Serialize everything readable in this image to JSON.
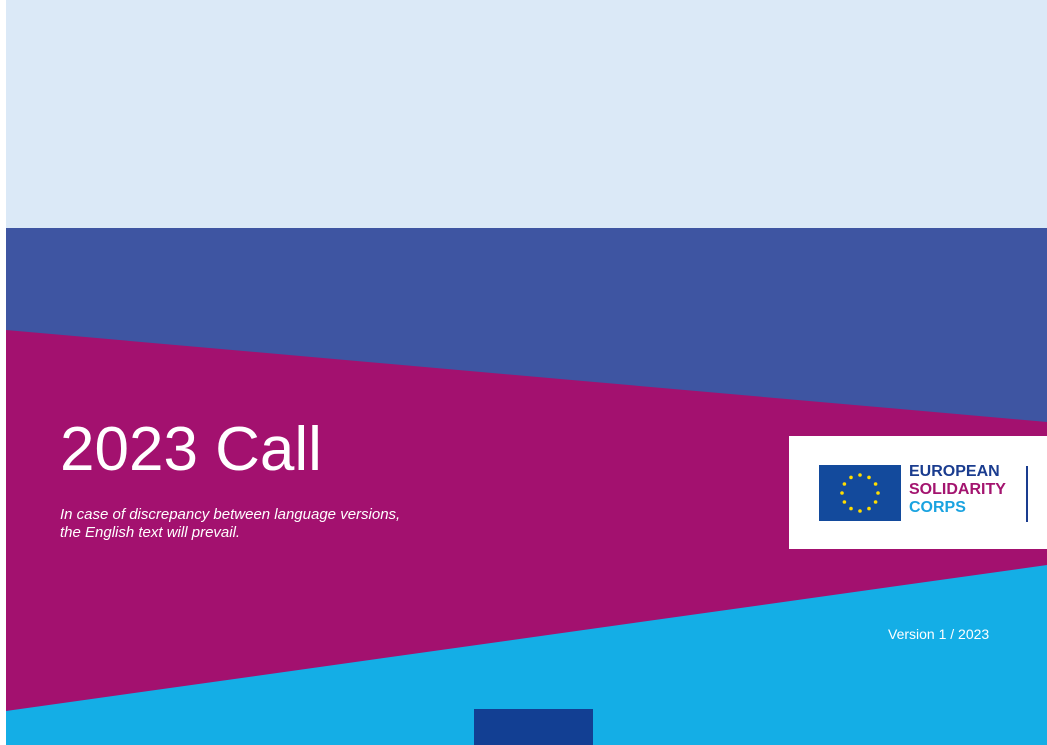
{
  "cover": {
    "title": "2023 Call",
    "disclaimer_line_1": "In case of discrepancy between language versions,",
    "disclaimer_line_2": "the English text will prevail.",
    "version": "Version 1 / 2023"
  },
  "logo": {
    "line_1": "EUROPEAN",
    "line_2": "SOLIDARITY",
    "line_3": "CORPS",
    "flag_icon": "eu-flag-icon"
  },
  "colors": {
    "light_blue": "#dbe9f7",
    "dark_blue": "#3e55a2",
    "magenta": "#a3116f",
    "cyan": "#14aee6",
    "navy": "#123f93",
    "eu_blue": "#134a9c",
    "eu_yellow": "#ffdd00"
  }
}
